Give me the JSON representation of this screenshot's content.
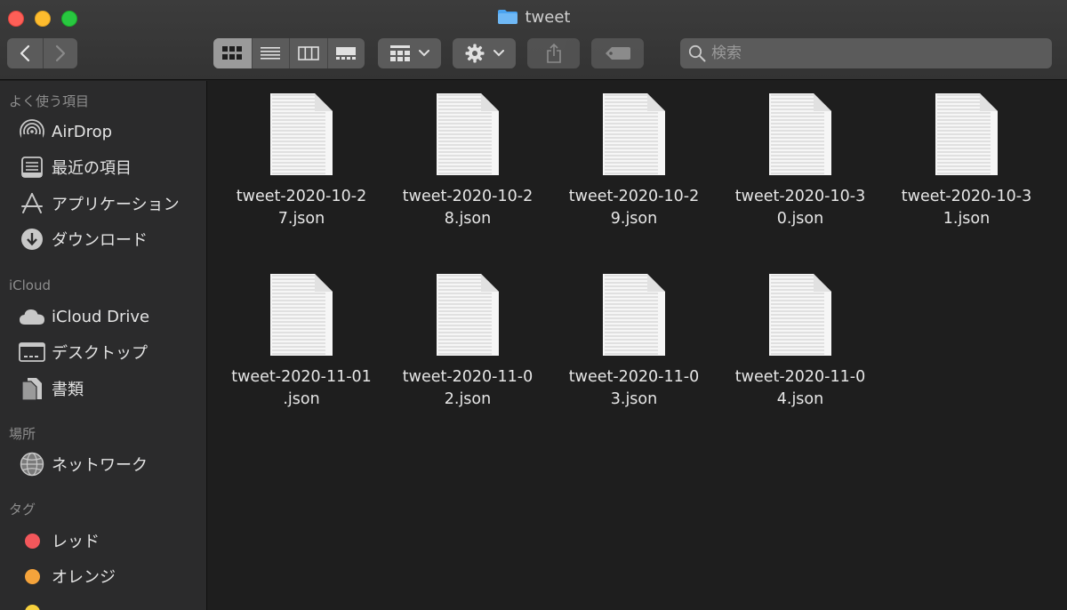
{
  "window": {
    "title": "tweet"
  },
  "toolbar": {
    "search_placeholder": "検索"
  },
  "sidebar": {
    "sections": [
      {
        "title": "よく使う項目",
        "items": [
          {
            "label": "AirDrop",
            "icon": "airdrop-icon"
          },
          {
            "label": "最近の項目",
            "icon": "recents-icon"
          },
          {
            "label": "アプリケーション",
            "icon": "applications-icon"
          },
          {
            "label": "ダウンロード",
            "icon": "downloads-icon"
          }
        ]
      },
      {
        "title": "iCloud",
        "items": [
          {
            "label": "iCloud Drive",
            "icon": "cloud-icon"
          },
          {
            "label": "デスクトップ",
            "icon": "desktop-icon"
          },
          {
            "label": "書類",
            "icon": "documents-icon"
          }
        ]
      },
      {
        "title": "場所",
        "items": [
          {
            "label": "ネットワーク",
            "icon": "network-icon"
          }
        ]
      },
      {
        "title": "タグ",
        "items": [
          {
            "label": "レッド",
            "icon": "tag-red-icon",
            "color": "#f3575b"
          },
          {
            "label": "オレンジ",
            "icon": "tag-orange-icon",
            "color": "#f5a33b"
          }
        ]
      }
    ]
  },
  "files": [
    {
      "line1": "tweet-2020-10-2",
      "line2": "7.json"
    },
    {
      "line1": "tweet-2020-10-2",
      "line2": "8.json"
    },
    {
      "line1": "tweet-2020-10-2",
      "line2": "9.json"
    },
    {
      "line1": "tweet-2020-10-3",
      "line2": "0.json"
    },
    {
      "line1": "tweet-2020-10-3",
      "line2": "1.json"
    },
    {
      "line1": "tweet-2020-11-01",
      "line2": ".json"
    },
    {
      "line1": "tweet-2020-11-0",
      "line2": "2.json"
    },
    {
      "line1": "tweet-2020-11-0",
      "line2": "3.json"
    },
    {
      "line1": "tweet-2020-11-0",
      "line2": "4.json"
    }
  ],
  "colors": {
    "accent_folder": "#4aa3f0",
    "close": "#fe5f57",
    "minimize": "#febc2e",
    "maximize": "#28c840"
  }
}
